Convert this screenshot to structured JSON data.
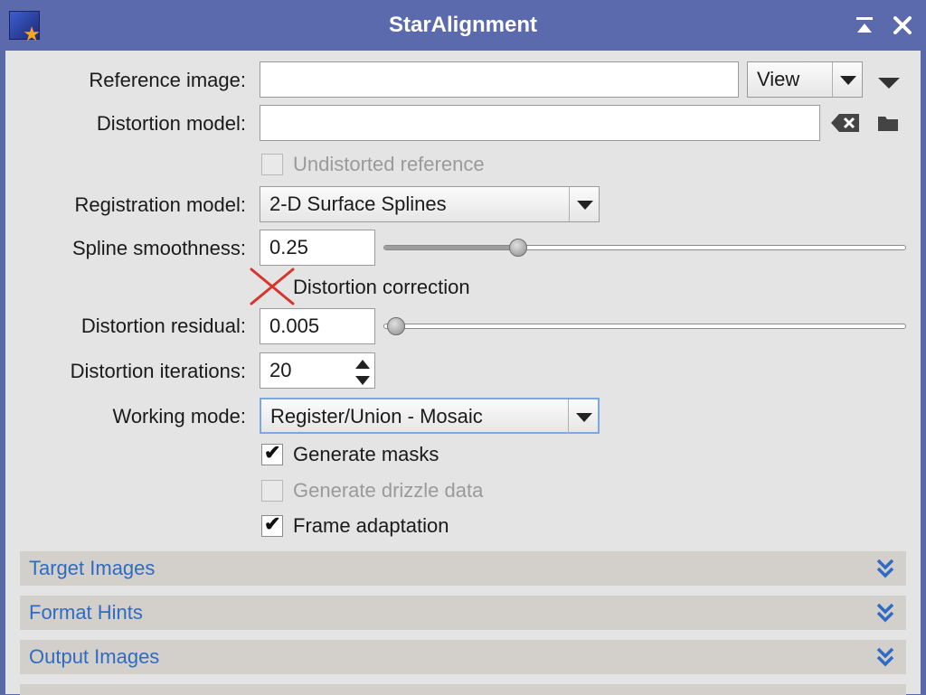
{
  "window": {
    "title": "StarAlignment",
    "title_icon": "staralignment-app-icon",
    "buttons": [
      "shade-icon",
      "close-icon"
    ]
  },
  "reference_image": {
    "label": "Reference image:",
    "value": "",
    "view_label": "View",
    "menu_icon": "triangle-down-icon"
  },
  "distortion_model": {
    "label": "Distortion model:",
    "value": "",
    "clear_icon": "backspace-clear-icon",
    "browse_icon": "folder-icon"
  },
  "undistorted_reference": {
    "label": "Undistorted reference",
    "checked": false,
    "enabled": false
  },
  "registration_model": {
    "label": "Registration model:",
    "value": "2-D Surface Splines"
  },
  "spline_smoothness": {
    "label": "Spline smoothness:",
    "value": "0.25",
    "slider_fraction": 0.25
  },
  "distortion_correction": {
    "label": "Distortion correction",
    "checked": false,
    "marked_with_red_x": true
  },
  "distortion_residual": {
    "label": "Distortion residual:",
    "value": "0.005",
    "slider_fraction": 0.0
  },
  "distortion_iterations": {
    "label": "Distortion iterations:",
    "value": "20"
  },
  "working_mode": {
    "label": "Working mode:",
    "value": "Register/Union - Mosaic"
  },
  "generate_masks": {
    "label": "Generate masks",
    "checked": true
  },
  "generate_drizzle": {
    "label": "Generate drizzle data",
    "checked": false,
    "enabled": false
  },
  "frame_adaptation": {
    "label": "Frame adaptation",
    "checked": true
  },
  "sections": [
    {
      "label": "Target Images"
    },
    {
      "label": "Format Hints"
    },
    {
      "label": "Output Images"
    }
  ],
  "colors": {
    "titlebar": "#5b69ad",
    "panel": "#e4e4e4",
    "section_text": "#2f6bc4",
    "focus": "#7aa8e6"
  }
}
